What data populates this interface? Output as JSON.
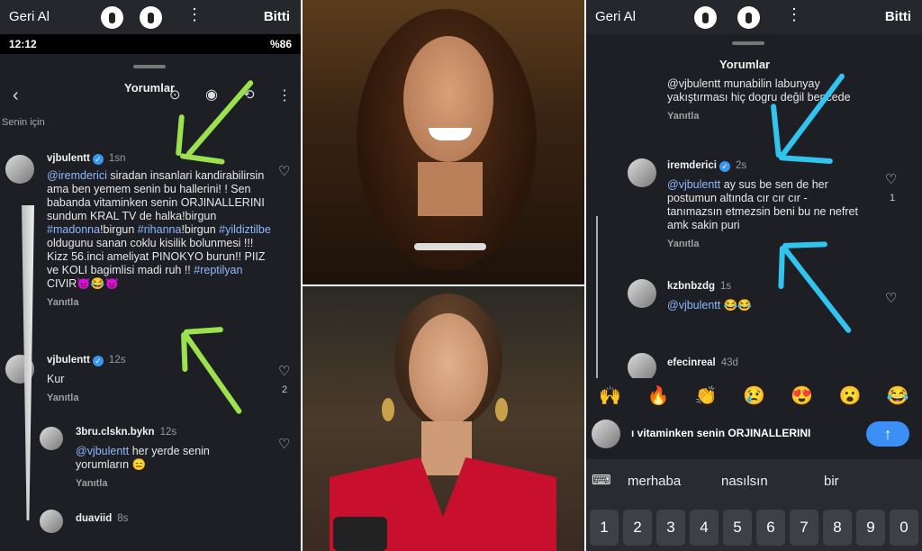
{
  "left": {
    "topbar": {
      "back": "Geri Al",
      "done": "Bitti"
    },
    "status": {
      "time": "12:12",
      "battery": "%86"
    },
    "sheet_title": "Yorumlar",
    "filter": "Senin için",
    "comments": [
      {
        "user": "vjbulentt",
        "time": "1sn",
        "mention": "@iremderici",
        "text": " siradan insanlari kandirabilirsin ama ben yemem senin bu hallerini! ! Sen babanda vitaminken senin ORJINALLERINI  sundum KRAL TV de halka!birgun  ",
        "hashtag1": "#madonna",
        "text2": "!birgun ",
        "hashtag2": "#rihanna",
        "text3": "!birgun ",
        "hashtag3": "#yildiztilbe",
        "text4": " oldugunu sanan coklu kisilik bolunmesi !!! Kizz 56.inci  ameliyat  PINOKYO  burun!! PIIZ ve KOLI  bagimlisi madi ruh !! ",
        "hashtag4": "#reptilyan",
        "text5": " CIVIR😈😂😈",
        "reply": "Yanıtla"
      },
      {
        "user": "vjbulentt",
        "time": "12s",
        "text": "Kur",
        "reply": "Yanıtla",
        "likes": "2"
      },
      {
        "user": "3bru.clskn.bykn",
        "time": "12s",
        "mention": "@vjbulentt",
        "text": " her yerde senin yorumların 😑",
        "reply": "Yanıtla"
      },
      {
        "user": "duaviid",
        "time": "8s"
      }
    ]
  },
  "right": {
    "topbar": {
      "back": "Geri Al",
      "done": "Bitti"
    },
    "sheet_title": "Yorumlar",
    "comments": [
      {
        "text": "@vjbulentt munabilin labunyay yakıştırması hiç dogru değil bencede",
        "reply": "Yanıtla"
      },
      {
        "user": "iremderici",
        "time": "2s",
        "mention": "@vjbulentt",
        "text": " ay sus be sen de her postumun altında cır cır cır - tanımazsın etmezsin beni bu ne nefret amk sakin puri",
        "reply": "Yanıtla",
        "likes": "1"
      },
      {
        "user": "kzbnbzdg",
        "time": "1s",
        "mention": "@vjbulentt",
        "text": " 😂😂"
      },
      {
        "user": "efecinreal",
        "time": "43d"
      }
    ],
    "emojis": [
      "🙌",
      "🔥",
      "👏",
      "😢",
      "😍",
      "😮",
      "😂"
    ],
    "input_text": "ı vitaminken senin ORJINALLERINI",
    "suggestions": [
      "merhaba",
      "nasılsın",
      "bir"
    ],
    "keys": [
      "1",
      "2",
      "3",
      "4",
      "5",
      "6",
      "7",
      "8",
      "9",
      "0"
    ]
  }
}
